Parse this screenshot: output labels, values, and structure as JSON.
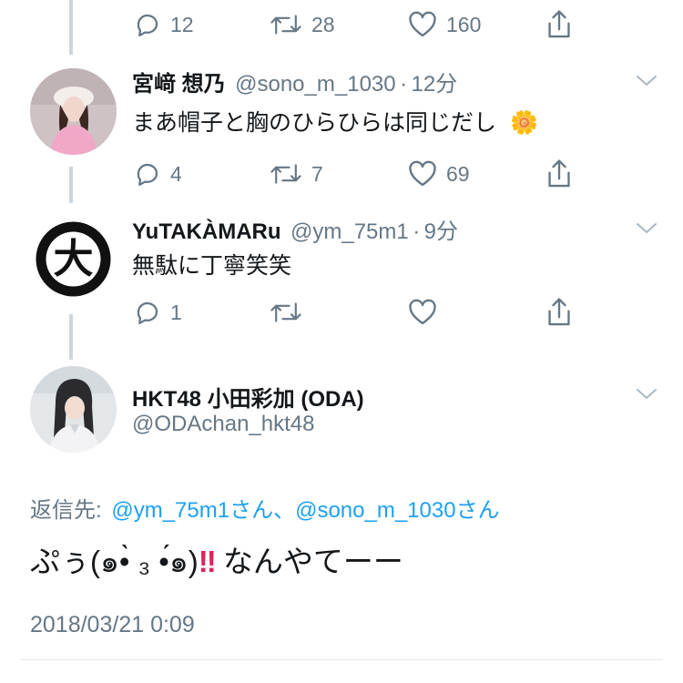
{
  "tweets": [
    {
      "counts": {
        "reply": "12",
        "retweet": "28",
        "like": "160"
      }
    },
    {
      "display_name": "宮﨑 想乃",
      "handle": "@sono_m_1030",
      "dot": "·",
      "time": "12分",
      "text": "まあ帽子と胸のひらひらは同じだし",
      "emoji": "🌼",
      "counts": {
        "reply": "4",
        "retweet": "7",
        "like": "69"
      }
    },
    {
      "display_name": "YuTAKÀMARu",
      "handle": "@ym_75m1",
      "dot": "·",
      "time": "9分",
      "text": "無駄に丁寧笑笑",
      "avatar_glyph": "大",
      "counts": {
        "reply": "1",
        "retweet": "",
        "like": ""
      }
    }
  ],
  "main_tweet": {
    "display_name": "HKT48 小田彩加 (ODA)",
    "handle": "@ODAchan_hkt48",
    "reply_label": "返信先:",
    "reply_to": "@ym_75m1さん、@sono_m_1030さん",
    "text_before": "ぷぅ(๑•̀ ₃ •́๑)",
    "text_marks": "!!",
    "text_after": " なんやてーー",
    "timestamp": "2018/03/21 0:09"
  },
  "colors": {
    "link": "#1da1f2",
    "muted": "#657786",
    "thread_line": "#ccd6dd",
    "marks": "#e0245e"
  },
  "icons": {
    "reply": "reply-icon",
    "retweet": "retweet-icon",
    "like": "heart-icon",
    "share": "share-icon",
    "caret": "chevron-down-icon"
  }
}
